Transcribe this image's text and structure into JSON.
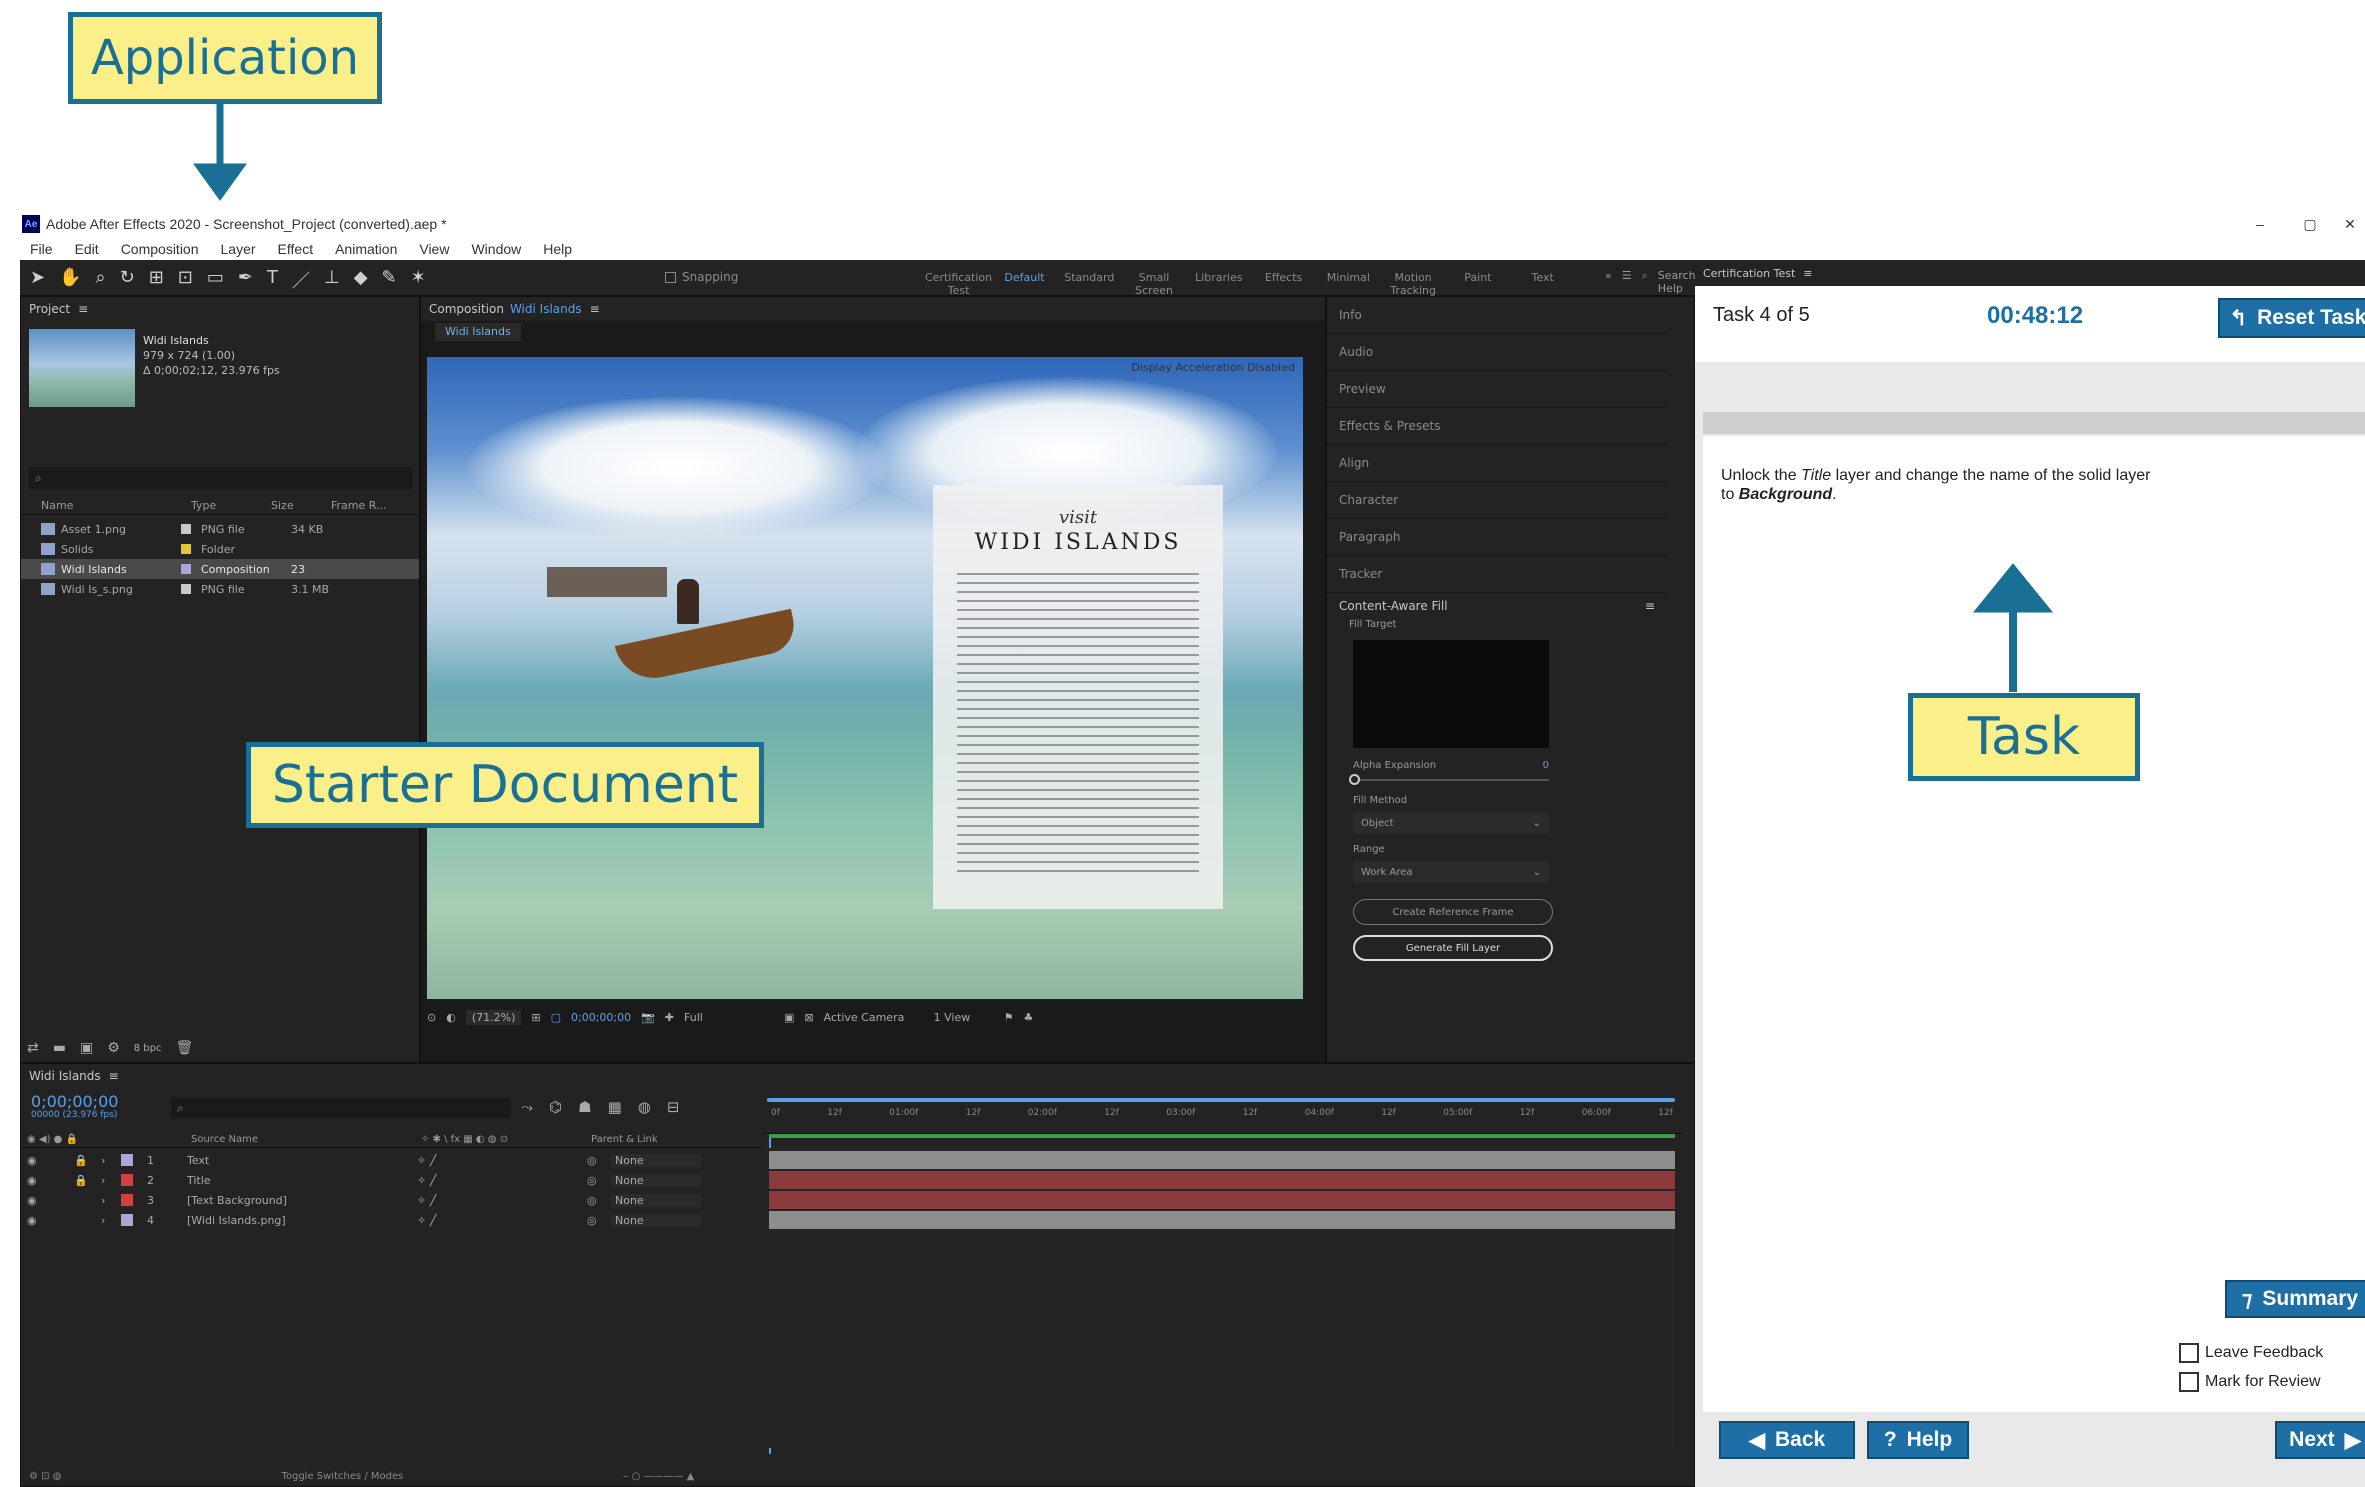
{
  "callouts": {
    "application": "Application",
    "starter_document": "Starter Document",
    "task": "Task"
  },
  "window": {
    "title": "Adobe After Effects 2020 - Screenshot_Project (converted).aep *",
    "menu": [
      "File",
      "Edit",
      "Composition",
      "Layer",
      "Effect",
      "Animation",
      "View",
      "Window",
      "Help"
    ]
  },
  "workspaces": [
    "Certification Test",
    "Default",
    "Standard",
    "Small Screen",
    "Libraries",
    "Effects",
    "Minimal",
    "Motion Tracking",
    "Paint",
    "Text"
  ],
  "search_help": "Search Help",
  "snapping": "Snapping",
  "project": {
    "header": "Project",
    "thumb_name": "Widi Islands",
    "thumb_info1": "979 x 724 (1.00)",
    "thumb_info2": "Δ 0;00;02;12, 23.976 fps",
    "columns": [
      "Name",
      "Type",
      "Size",
      "Frame R..."
    ],
    "items": [
      {
        "name": "Asset 1.png",
        "type": "PNG file",
        "size": "34 KB",
        "color": "#c8c8c8"
      },
      {
        "name": "Solids",
        "type": "Folder",
        "size": "",
        "color": "#e6c337"
      },
      {
        "name": "Widi Islands",
        "type": "Composition",
        "size": "23",
        "color": "#a7a7d6"
      },
      {
        "name": "Widi Is_s.png",
        "type": "PNG file",
        "size": "3.1 MB",
        "color": "#c8c8c8"
      }
    ],
    "bpc": "8 bpc"
  },
  "composition": {
    "header": "Composition",
    "name": "Widi Islands",
    "tab": "Widi Islands",
    "accel_notice": "Display Acceleration Disabled",
    "card_visit": "visit",
    "card_title": "WIDI ISLANDS",
    "zoom": "(71.2%)",
    "time": "0;00;00;00",
    "resolution": "Full",
    "camera": "Active Camera",
    "views": "1 View"
  },
  "right_panels": [
    "Info",
    "Audio",
    "Preview",
    "Effects & Presets",
    "Align",
    "Character",
    "Paragraph",
    "Tracker"
  ],
  "content_aware": {
    "header": "Content-Aware Fill",
    "fill_target": "Fill Target",
    "alpha_expansion": "Alpha Expansion",
    "alpha_value": "0",
    "fill_method": "Fill Method",
    "fill_method_value": "Object",
    "range": "Range",
    "range_value": "Work Area",
    "btn_reference": "Create Reference Frame",
    "btn_generate": "Generate Fill Layer"
  },
  "timeline": {
    "tab": "Widi Islands",
    "timecode": "0;00;00;00",
    "fps": "00000 (23.976 fps)",
    "columns": [
      "Source Name",
      "Parent & Link"
    ],
    "layers": [
      {
        "num": "1",
        "name": "Text",
        "parent": "None",
        "color": "#a7a7d6",
        "locked": true,
        "track": "#8d8d8d"
      },
      {
        "num": "2",
        "name": "Title",
        "parent": "None",
        "color": "#d44040",
        "locked": true,
        "track": "#8a3a3a"
      },
      {
        "num": "3",
        "name": "[Text Background]",
        "parent": "None",
        "color": "#d44040",
        "locked": false,
        "track": "#8a3a3a"
      },
      {
        "num": "4",
        "name": "[Widi Islands.png]",
        "parent": "None",
        "color": "#a7a7d6",
        "locked": false,
        "track": "#8d8d8d"
      }
    ],
    "ruler": [
      "0f",
      "12f",
      "01:00f",
      "12f",
      "02:00f",
      "12f",
      "03:00f",
      "12f",
      "04:00f",
      "12f",
      "05:00f",
      "12f",
      "06:00f",
      "12f"
    ],
    "toggle": "Toggle Switches / Modes"
  },
  "task": {
    "panel_header": "Certification Test",
    "counter": "Task 4 of 5",
    "timer": "00:48:12",
    "reset": "Reset Task",
    "instruction_1": "Unlock the ",
    "instruction_title": "Title",
    "instruction_2": " layer and change the name of the solid layer",
    "instruction_3": "to ",
    "instruction_bg": "Background",
    "instruction_4": ".",
    "summary": "Summary",
    "leave_feedback": "Leave Feedback",
    "mark_review": "Mark for Review",
    "back": "Back",
    "help": "Help",
    "next": "Next"
  },
  "colors": {
    "accent": "#1d6fa5",
    "callout_bg": "#fbef8a",
    "callout_border": "#1a6f94",
    "timer": "#1d6fa5"
  }
}
